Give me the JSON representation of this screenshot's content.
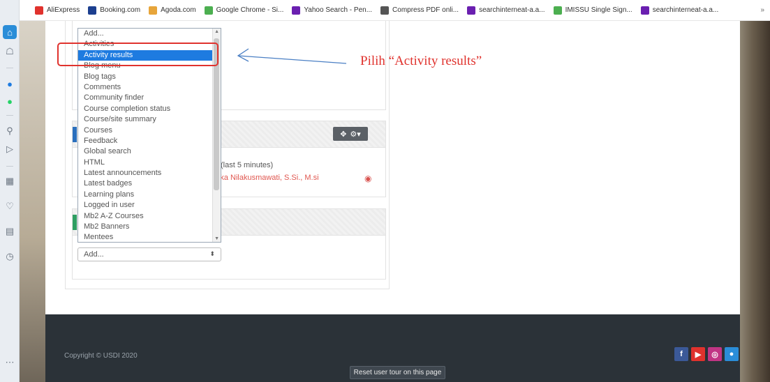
{
  "bookmarks": [
    {
      "label": "AliExpress",
      "color": "#e0322d"
    },
    {
      "label": "Booking.com",
      "color": "#1c3f8f"
    },
    {
      "label": "Agoda.com",
      "color": "#e7a53a"
    },
    {
      "label": "Google Chrome - Si...",
      "color": "#4caf50"
    },
    {
      "label": "Yahoo Search - Pen...",
      "color": "#6a1fb0"
    },
    {
      "label": "Compress PDF onli...",
      "color": "#555555"
    },
    {
      "label": "searchinterneat-a.a...",
      "color": "#6a1fb0"
    },
    {
      "label": "IMISSU Single Sign...",
      "color": "#4caf50"
    },
    {
      "label": "searchinterneat-a.a...",
      "color": "#6a1fb0"
    }
  ],
  "bookmarks_more": "»",
  "dropdown": {
    "options": [
      "Add...",
      "Activities",
      "Activity results",
      "Blog menu",
      "Blog tags",
      "Comments",
      "Community finder",
      "Course completion status",
      "Course/site summary",
      "Courses",
      "Feedback",
      "Global search",
      "HTML",
      "Latest announcements",
      "Latest badges",
      "Learning plans",
      "Logged in user",
      "Mb2 A-Z Courses",
      "Mb2 Banners",
      "Mentees"
    ],
    "selected": "Activity results"
  },
  "add_select": {
    "value": "Add..."
  },
  "online_users": {
    "period": "(last 5 minutes)",
    "user": "Eka Nilakusmawati, S.Si., M.si"
  },
  "annotation": {
    "text": "Pilih “Activity results”"
  },
  "footer": {
    "copyright": "Copyright © USDI 2020",
    "reset_tour": "Reset user tour on this page",
    "social": [
      {
        "icon": "facebook-icon",
        "glyph": "f",
        "color": "#3b5998"
      },
      {
        "icon": "youtube-icon",
        "glyph": "▶",
        "color": "#e0322d"
      },
      {
        "icon": "instagram-icon",
        "glyph": "◎",
        "color": "#c13584"
      },
      {
        "icon": "globe-icon",
        "glyph": "●",
        "color": "#2a8dd8"
      }
    ]
  },
  "colors": {
    "accent": "#1e7be0",
    "annotation": "#e0322d"
  }
}
